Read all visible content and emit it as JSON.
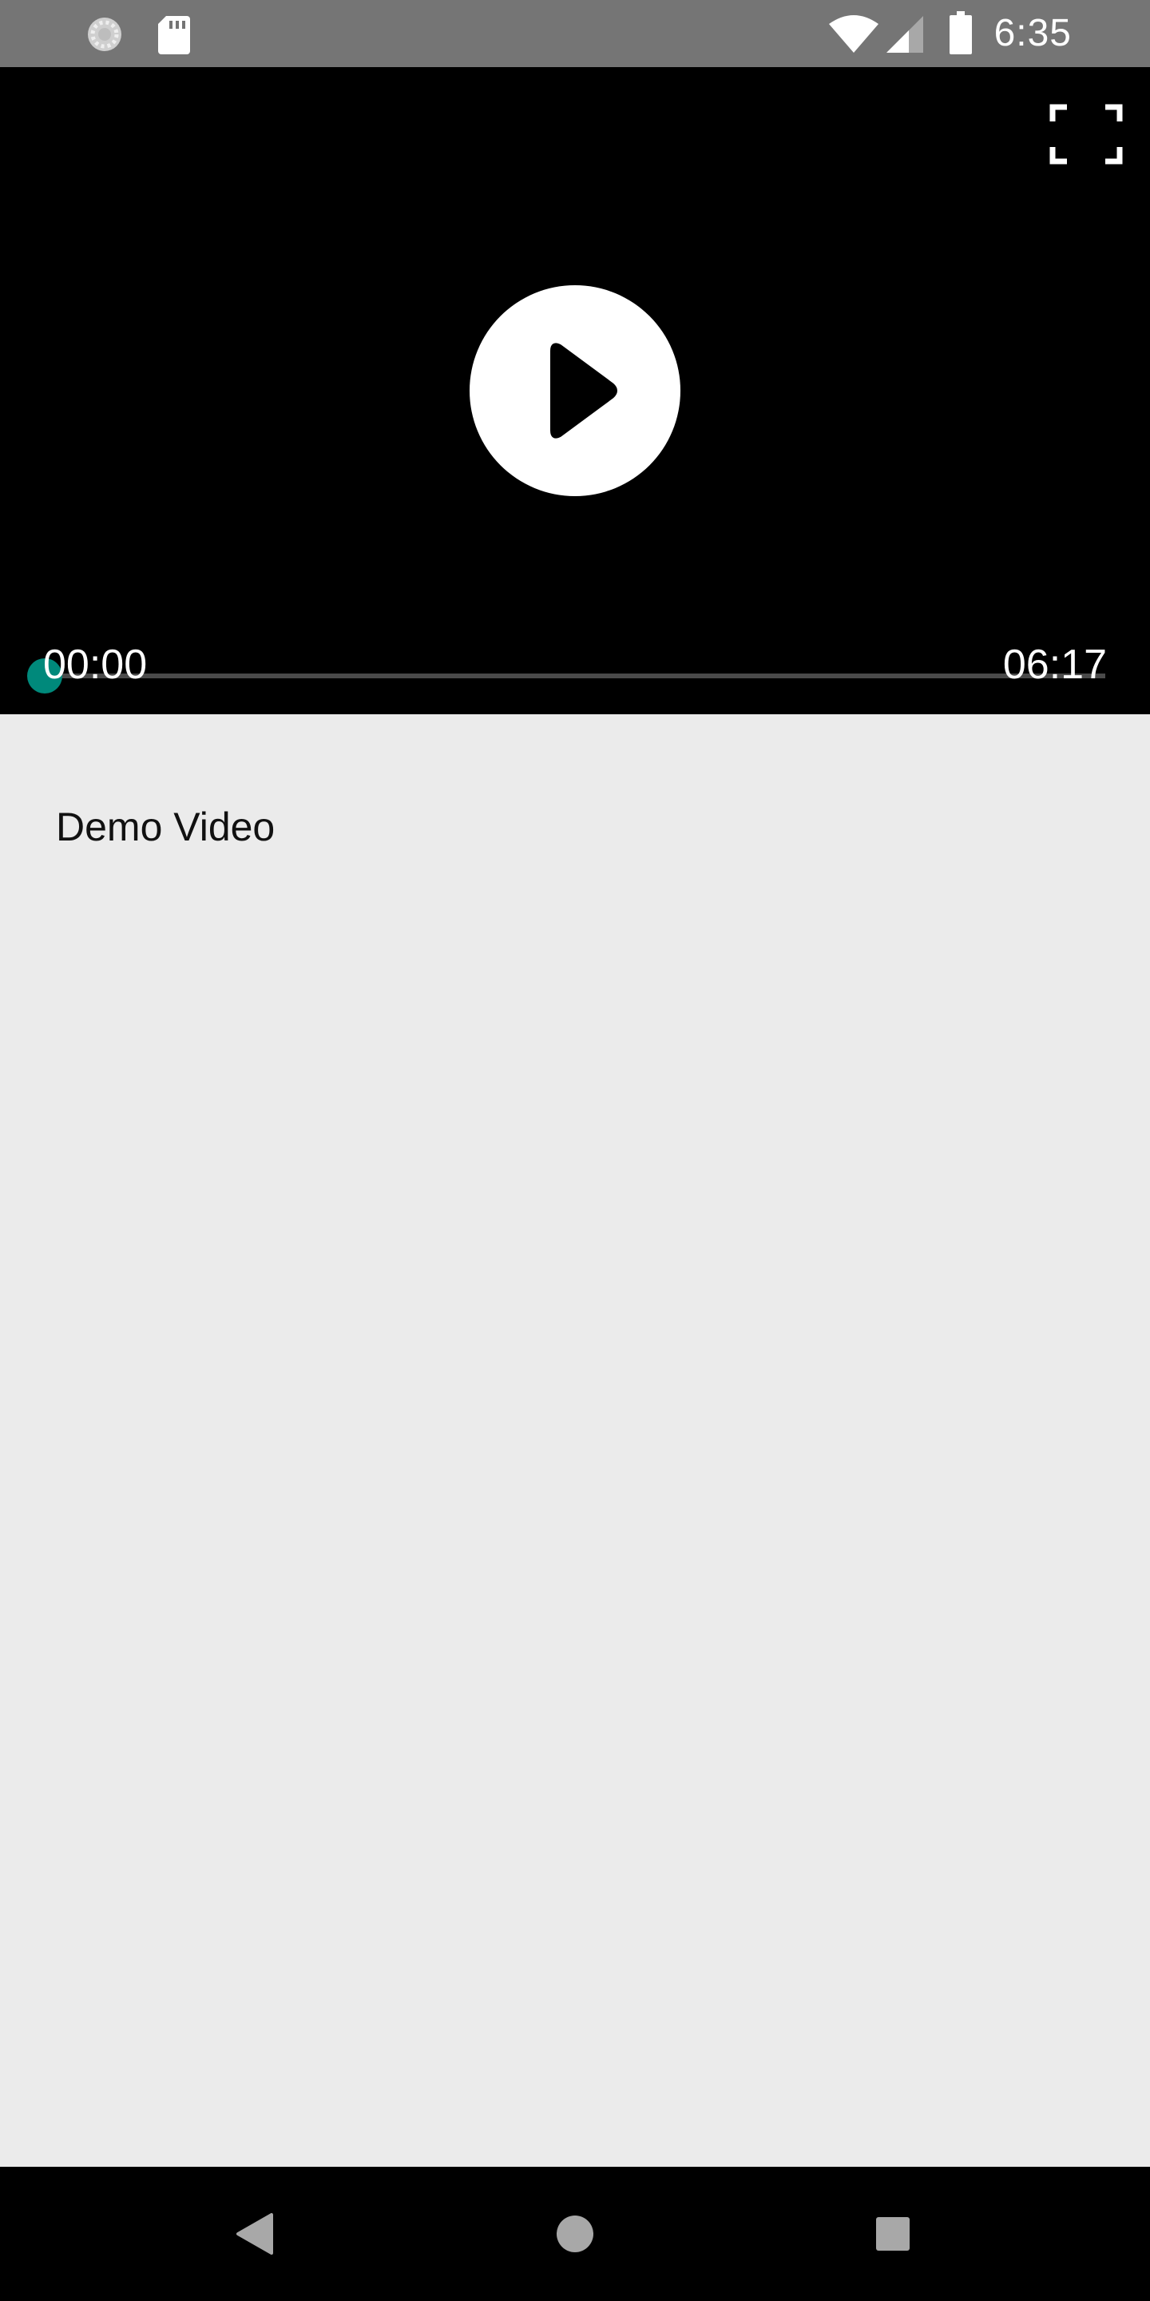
{
  "status_bar": {
    "time": "6:35",
    "icons": [
      "loading-icon",
      "sd-card-icon",
      "wifi-icon",
      "cell-signal-icon",
      "battery-icon"
    ]
  },
  "video_player": {
    "current_time": "00:00",
    "total_time": "06:17",
    "progress": 0,
    "accent_color": "#00897b",
    "icons": [
      "fullscreen-icon",
      "play-icon"
    ]
  },
  "content": {
    "title": "Demo Video"
  },
  "nav_bar": {
    "icons": [
      "back-icon",
      "home-icon",
      "recents-icon"
    ]
  },
  "colors": {
    "status_bar": "#757575",
    "player_background": "#000000",
    "page_background": "#ebebeb",
    "nav_bar": "#000000"
  }
}
